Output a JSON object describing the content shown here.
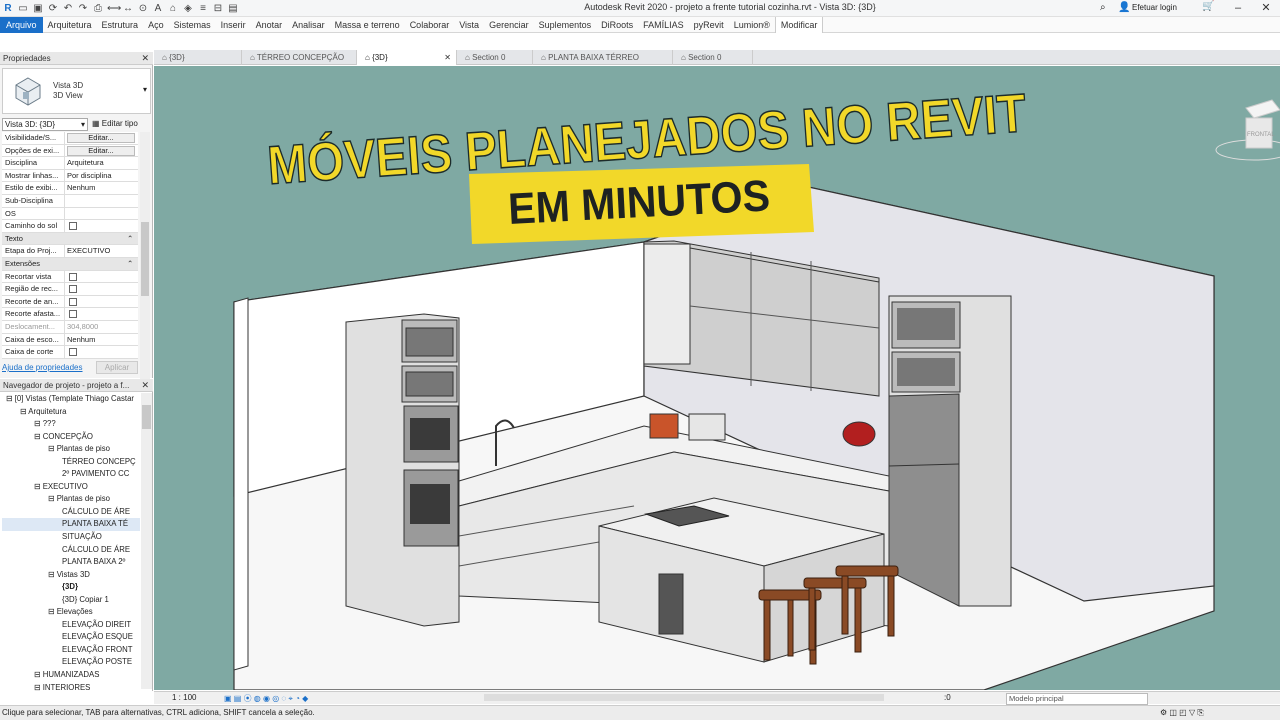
{
  "app": {
    "title": "Autodesk Revit 2020 - projeto a frente tutorial cozinha.rvt - Vista 3D: {3D}",
    "login": "Efetuar login"
  },
  "ribbon": {
    "tabs": [
      "Arquivo",
      "Arquitetura",
      "Estrutura",
      "Aço",
      "Sistemas",
      "Inserir",
      "Anotar",
      "Analisar",
      "Massa e terreno",
      "Colaborar",
      "Vista",
      "Gerenciar",
      "Suplementos",
      "DiRoots",
      "FAMÍLIAS",
      "pyRevit",
      "Lumion®",
      "Modificar"
    ],
    "active": "Modificar"
  },
  "properties": {
    "header": "Propriedades",
    "type_name": "Vista 3D",
    "type_sub": "3D View",
    "filter": "Vista 3D: {3D}",
    "edit_type": "Editar tipo",
    "rows": [
      {
        "k": "Visibilidade/S...",
        "v": "Editar...",
        "kind": "btn"
      },
      {
        "k": "Opções de exi...",
        "v": "Editar...",
        "kind": "btn"
      },
      {
        "k": "Disciplina",
        "v": "Arquitetura",
        "kind": "text"
      },
      {
        "k": "Mostrar linhas...",
        "v": "Por disciplina",
        "kind": "text"
      },
      {
        "k": "Estilo de exibi...",
        "v": "Nenhum",
        "kind": "text"
      },
      {
        "k": "Sub-Disciplina",
        "v": "",
        "kind": "text"
      },
      {
        "k": "OS",
        "v": "",
        "kind": "text"
      },
      {
        "k": "Caminho do sol",
        "v": "",
        "kind": "cb"
      },
      {
        "k": "Texto",
        "v": "",
        "kind": "sec"
      },
      {
        "k": "Etapa do Proj...",
        "v": "EXECUTIVO",
        "kind": "text"
      },
      {
        "k": "Extensões",
        "v": "",
        "kind": "sec"
      },
      {
        "k": "Recortar vista",
        "v": "",
        "kind": "cb"
      },
      {
        "k": "Região de rec...",
        "v": "",
        "kind": "cb"
      },
      {
        "k": "Recorte de an...",
        "v": "",
        "kind": "cb"
      },
      {
        "k": "Recorte afasta...",
        "v": "",
        "kind": "cb"
      },
      {
        "k": "Deslocament...",
        "v": "304,8000",
        "kind": "dim"
      },
      {
        "k": "Caixa de esco...",
        "v": "Nenhum",
        "kind": "text"
      },
      {
        "k": "Caixa de corte",
        "v": "",
        "kind": "cb"
      }
    ],
    "help": "Ajuda de propriedades",
    "apply": "Aplicar"
  },
  "browser": {
    "header": "Navegador de projeto - projeto a f...",
    "items": [
      {
        "t": "[0] Vistas (Template Thiago Castar",
        "lvl": 0
      },
      {
        "t": "Arquitetura",
        "lvl": 1
      },
      {
        "t": "???",
        "lvl": 2
      },
      {
        "t": "CONCEPÇÃO",
        "lvl": 2
      },
      {
        "t": "Plantas de piso",
        "lvl": 3
      },
      {
        "t": "TÉRREO CONCEPÇ",
        "lvl": 4
      },
      {
        "t": "2º PAVIMENTO CC",
        "lvl": 4
      },
      {
        "t": "EXECUTIVO",
        "lvl": 2
      },
      {
        "t": "Plantas de piso",
        "lvl": 3
      },
      {
        "t": "CÁLCULO DE ÁRE",
        "lvl": 4
      },
      {
        "t": "PLANTA BAIXA TÉ",
        "lvl": 4,
        "sel": true
      },
      {
        "t": "SITUAÇÃO",
        "lvl": 4
      },
      {
        "t": "CÁLCULO DE ÁRE",
        "lvl": 4
      },
      {
        "t": "PLANTA BAIXA 2º",
        "lvl": 4
      },
      {
        "t": "Vistas 3D",
        "lvl": 3
      },
      {
        "t": "{3D}",
        "lvl": 4,
        "bold": true
      },
      {
        "t": "{3D} Copiar 1",
        "lvl": 4
      },
      {
        "t": "Elevações",
        "lvl": 3
      },
      {
        "t": "ELEVAÇÃO DIREIT",
        "lvl": 4
      },
      {
        "t": "ELEVAÇÃO ESQUE",
        "lvl": 4
      },
      {
        "t": "ELEVAÇÃO FRONT",
        "lvl": 4
      },
      {
        "t": "ELEVAÇÃO POSTE",
        "lvl": 4
      },
      {
        "t": "HUMANIZADAS",
        "lvl": 2
      },
      {
        "t": "INTERIORES",
        "lvl": 2
      }
    ]
  },
  "doc_tabs": [
    {
      "label": "{3D}",
      "active": false
    },
    {
      "label": "TÉRREO CONCEPÇÃO",
      "active": false
    },
    {
      "label": "{3D}",
      "active": true
    },
    {
      "label": "Section 0",
      "active": false
    },
    {
      "label": "PLANTA BAIXA TÉRREO",
      "active": false
    },
    {
      "label": "Section 0",
      "active": false
    }
  ],
  "overlay": {
    "headline": "MÓVEIS PLANEJADOS NO REVIT",
    "tagline": "EM MINUTOS"
  },
  "viewcube": {
    "left": "FRONTAL",
    "right": "DIREITA"
  },
  "view_controls": {
    "scale": "1 : 100",
    "model": "Modelo principal",
    "coords": ":0"
  },
  "status": "Clique para selecionar, TAB para alternativas, CTRL adiciona, SHIFT cancela a seleção.",
  "colors": {
    "accent": "#1a6fc9",
    "viewport_bg": "#7fa9a3",
    "headline_yellow": "#f2d829"
  }
}
